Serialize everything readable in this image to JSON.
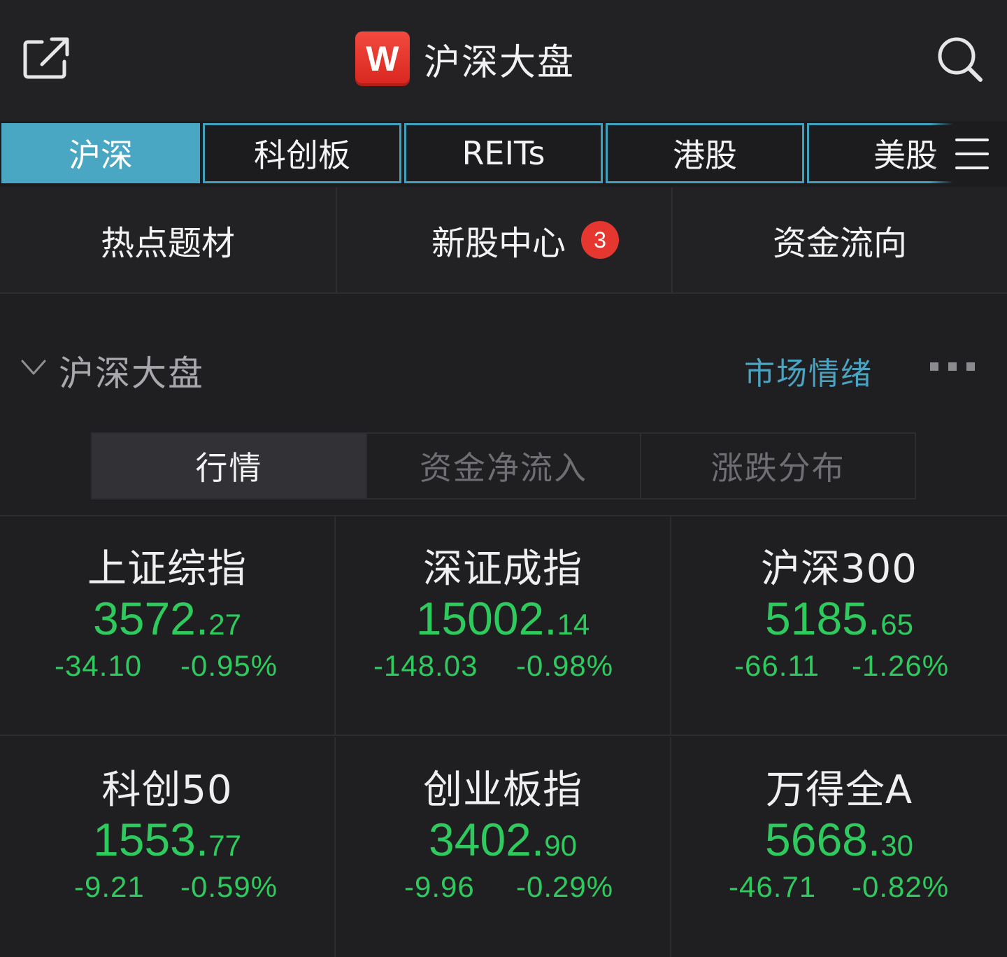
{
  "header": {
    "title": "沪深大盘",
    "logo_text": "W",
    "share_icon": "share-icon",
    "search_icon": "search-icon"
  },
  "market_tabs": [
    {
      "label": "沪深",
      "active": true
    },
    {
      "label": "科创板",
      "active": false
    },
    {
      "label": "REITs",
      "active": false
    },
    {
      "label": "港股",
      "active": false
    },
    {
      "label": "美股",
      "active": false
    }
  ],
  "shortcuts": [
    {
      "label": "热点题材"
    },
    {
      "label": "新股中心",
      "badge": "3"
    },
    {
      "label": "资金流向"
    }
  ],
  "section": {
    "title": "沪深大盘",
    "link": "市场情绪"
  },
  "segments": [
    {
      "label": "行情",
      "active": true
    },
    {
      "label": "资金净流入",
      "active": false
    },
    {
      "label": "涨跌分布",
      "active": false
    }
  ],
  "indices": [
    {
      "name": "上证综指",
      "price_int": "3572.",
      "price_dec": "27",
      "change": "-34.10",
      "pct": "-0.95%"
    },
    {
      "name": "深证成指",
      "price_int": "15002.",
      "price_dec": "14",
      "change": "-148.03",
      "pct": "-0.98%"
    },
    {
      "name": "沪深300",
      "price_int": "5185.",
      "price_dec": "65",
      "change": "-66.11",
      "pct": "-1.26%"
    },
    {
      "name": "科创50",
      "price_int": "1553.",
      "price_dec": "77",
      "change": "-9.21",
      "pct": "-0.59%"
    },
    {
      "name": "创业板指",
      "price_int": "3402.",
      "price_dec": "90",
      "change": "-9.96",
      "pct": "-0.29%"
    },
    {
      "name": "万得全A",
      "price_int": "5668.",
      "price_dec": "30",
      "change": "-46.71",
      "pct": "-0.82%"
    }
  ],
  "colors": {
    "accent": "#4aa7c3",
    "down": "#2fca5d",
    "badge": "#e5362f",
    "background": "#1f1f22"
  }
}
